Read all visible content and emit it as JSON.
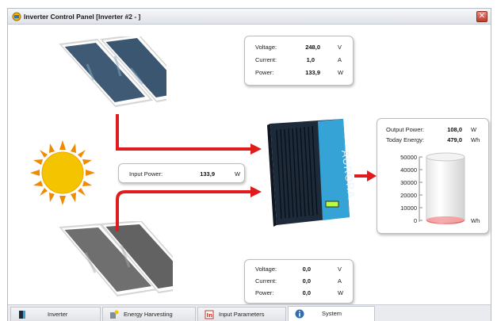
{
  "window": {
    "title": "Inverter Control Panel [Inverter #2 - ]"
  },
  "panel_top": {
    "rows": [
      {
        "label": "Voltage:",
        "value": "248,0",
        "unit": "V"
      },
      {
        "label": "Current:",
        "value": "1,0",
        "unit": "A"
      },
      {
        "label": "Power:",
        "value": "133,9",
        "unit": "W"
      }
    ]
  },
  "input_power": {
    "label": "Input Power:",
    "value": "133,9",
    "unit": "W"
  },
  "panel_bottom": {
    "rows": [
      {
        "label": "Voltage:",
        "value": "0,0",
        "unit": "V"
      },
      {
        "label": "Current:",
        "value": "0,0",
        "unit": "A"
      },
      {
        "label": "Power:",
        "value": "0,0",
        "unit": "W"
      }
    ]
  },
  "output": {
    "rows": [
      {
        "label": "Output Power:",
        "value": "108,0",
        "unit": "W"
      },
      {
        "label": "Today Energy:",
        "value": "479,0",
        "unit": "Wh"
      }
    ],
    "gauge": {
      "ticks": [
        "50000",
        "40000",
        "30000",
        "20000",
        "10000",
        "0"
      ],
      "unit": "Wh",
      "fill_fraction": 0.01
    }
  },
  "inverter": {
    "brand": "AURORA"
  },
  "tabs": [
    {
      "label": "Inverter",
      "icon": "inverter-icon",
      "active": false
    },
    {
      "label": "Energy Harvesting",
      "icon": "energy-harvesting-icon",
      "active": false
    },
    {
      "label": "Input Parameters",
      "icon": "input-parameters-icon",
      "active": false
    },
    {
      "label": "System",
      "icon": "info-icon",
      "active": true
    }
  ],
  "colors": {
    "arrow": "#e01b1b",
    "sun": "#f5c400",
    "sun_rays": "#f08a00",
    "inverter_body": "#1d2a3a",
    "inverter_panel": "#35a3d6",
    "gauge_fill": "#ef6f6f"
  }
}
